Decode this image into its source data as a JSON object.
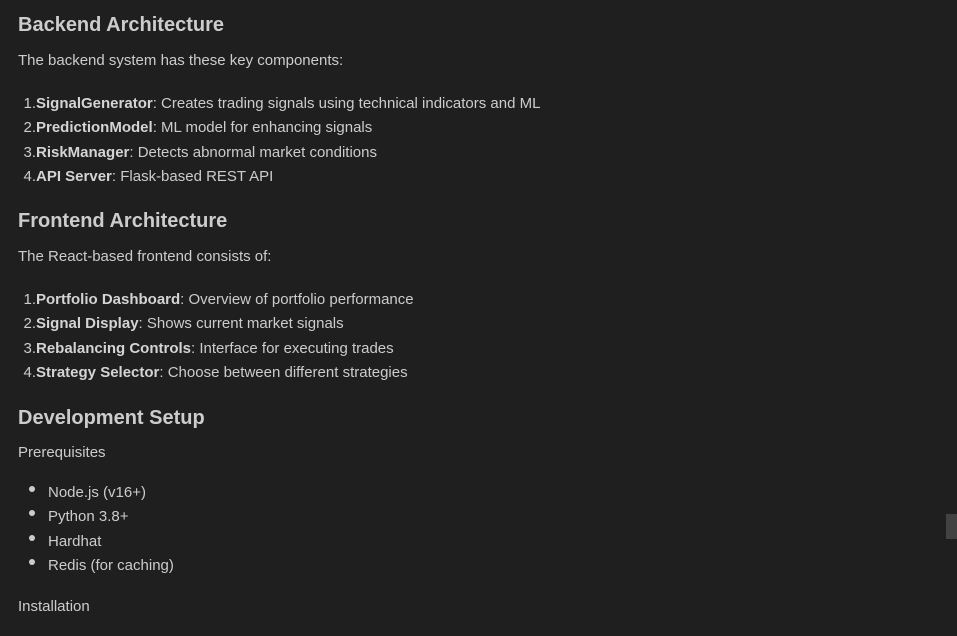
{
  "backend": {
    "heading": "Backend Architecture",
    "intro": "The backend system has these key components:",
    "items": [
      {
        "num": "1.",
        "term": "SignalGenerator",
        "desc": ": Creates trading signals using technical indicators and ML"
      },
      {
        "num": "2.",
        "term": "PredictionModel",
        "desc": ": ML model for enhancing signals"
      },
      {
        "num": "3.",
        "term": "RiskManager",
        "desc": ": Detects abnormal market conditions"
      },
      {
        "num": "4.",
        "term": "API Server",
        "desc": ": Flask-based REST API"
      }
    ]
  },
  "frontend": {
    "heading": "Frontend Architecture",
    "intro": "The React-based frontend consists of:",
    "items": [
      {
        "num": "1.",
        "term": "Portfolio Dashboard",
        "desc": ": Overview of portfolio performance"
      },
      {
        "num": "2.",
        "term": "Signal Display",
        "desc": ": Shows current market signals"
      },
      {
        "num": "3.",
        "term": "Rebalancing Controls",
        "desc": ": Interface for executing trades"
      },
      {
        "num": "4.",
        "term": "Strategy Selector",
        "desc": ": Choose between different strategies"
      }
    ]
  },
  "setup": {
    "heading": "Development Setup",
    "prereq_label": "Prerequisites",
    "prereqs": [
      "Node.js (v16+)",
      "Python 3.8+",
      "Hardhat",
      "Redis (for caching)"
    ],
    "install_label": "Installation"
  }
}
